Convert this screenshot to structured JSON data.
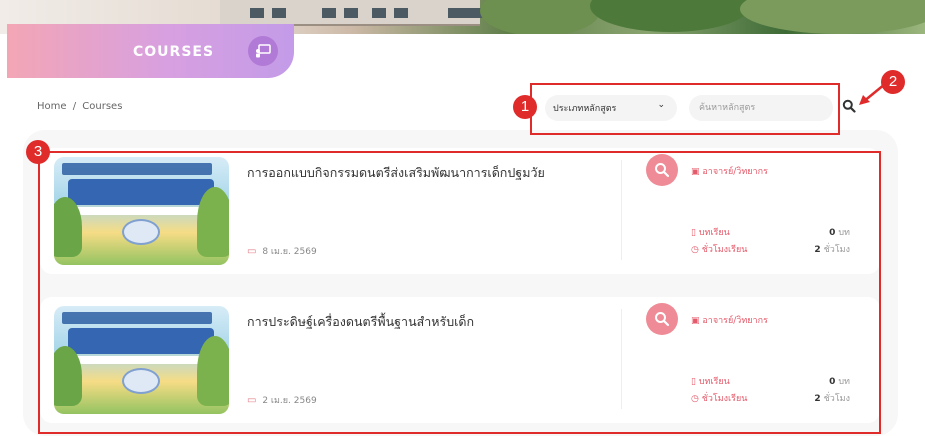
{
  "header": {
    "title": "COURSES",
    "icon": "chalkboard-teacher-icon"
  },
  "breadcrumb": {
    "home": "Home",
    "separator": "/",
    "current": "Courses"
  },
  "filter": {
    "selected": "ประเภทหลักสูตร",
    "chevron": "⌄"
  },
  "search": {
    "placeholder": "ค้นหาหลักสูตร",
    "value": "",
    "icon": "search-icon"
  },
  "annotations": {
    "one": "1",
    "two": "2",
    "three": "3"
  },
  "colors": {
    "accent": "#e55a6a",
    "annotation": "#e02b2b",
    "pill_start": "#f3a6b5",
    "pill_end": "#c39be8"
  },
  "courses": [
    {
      "title": "การออกแบบกิจกรรมดนตรีส่งเสริมพัฒนาการเด็กปฐมวัย",
      "date": "8 เม.ย. 2569",
      "instructor": "อาจารย์/วิทยากร",
      "lessons_label": "บทเรียน",
      "lessons_count": "0",
      "lessons_unit": "บท",
      "hours_label": "ชั่วโมงเรียน",
      "hours_count": "2",
      "hours_unit": "ชั่วโมง"
    },
    {
      "title": "การประดิษฐ์เครื่องดนตรีพื้นฐานสำหรับเด็ก",
      "date": "2 เม.ย. 2569",
      "instructor": "อาจารย์/วิทยากร",
      "lessons_label": "บทเรียน",
      "lessons_count": "0",
      "lessons_unit": "บท",
      "hours_label": "ชั่วโมงเรียน",
      "hours_count": "2",
      "hours_unit": "ชั่วโมง"
    }
  ]
}
